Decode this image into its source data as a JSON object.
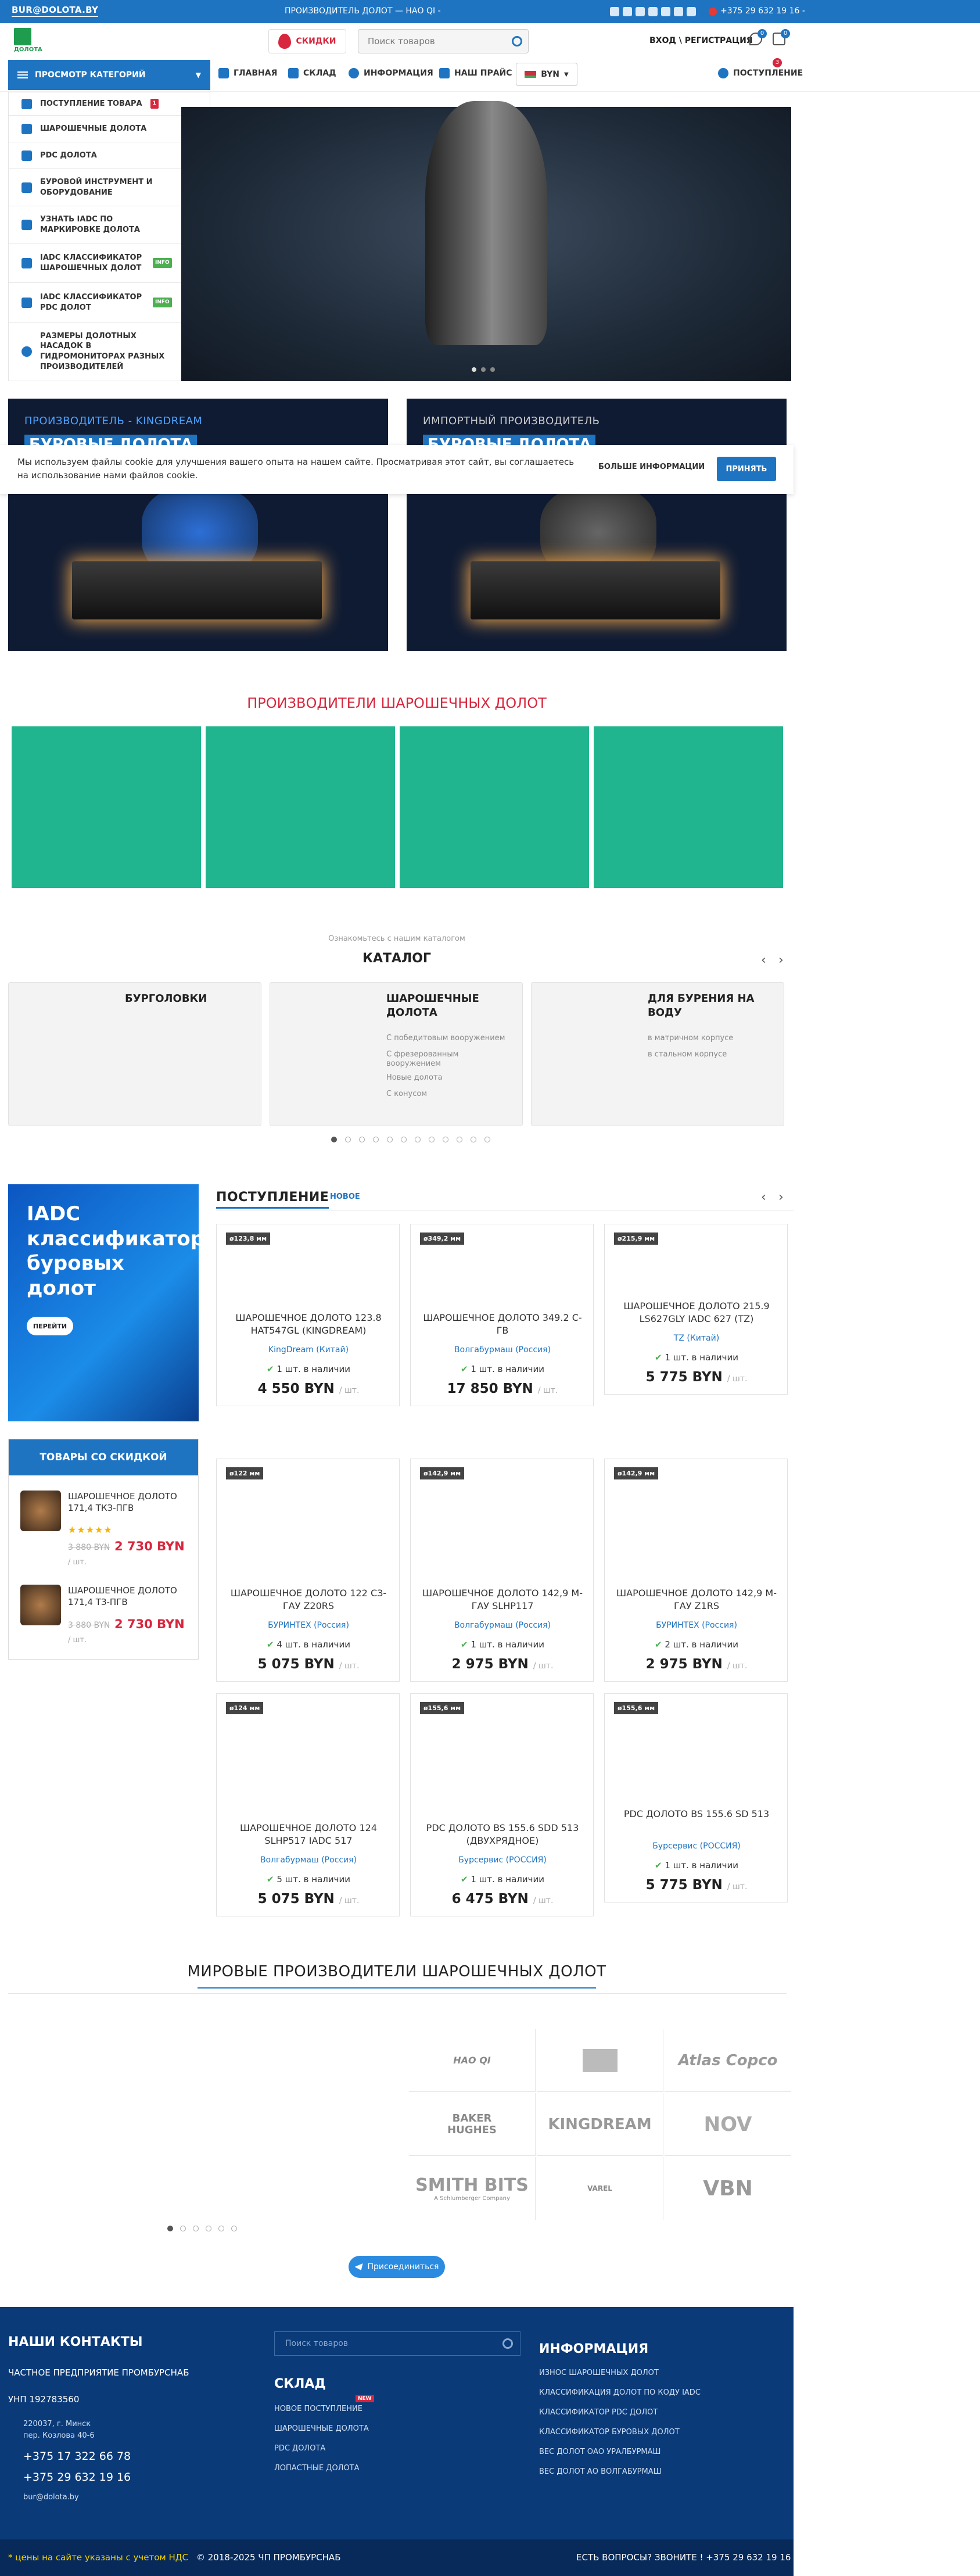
{
  "topbar": {
    "email": "BUR@DOLOTA.BY",
    "promo": "ПРОИЗВОДИТЕЛЬ ДОЛОТ — НАО QI -",
    "phone": "+375 29 632 19 16 -"
  },
  "header": {
    "logo_text": "ДОЛОТА",
    "sale_label": "СКИДКИ",
    "search_placeholder": "Поиск товаров",
    "login_label": "ВХОД \\ РЕГИСТРАЦИЯ",
    "wish_count": "0",
    "compare_count": "0"
  },
  "nav": {
    "category_button": "ПРОСМОТР КАТЕГОРИЙ",
    "items": [
      "ГЛАВНАЯ",
      "СКЛАД",
      "ИНФОРМАЦИЯ",
      "НАШ ПРАЙС"
    ],
    "currency": "BYN",
    "right_item": "ПОСТУПЛЕНИЕ",
    "right_badge": "3"
  },
  "categories": [
    {
      "label": "ПОСТУПЛЕНИЕ ТОВАРА",
      "tag": "1"
    },
    {
      "label": "ШАРОШЕЧНЫЕ ДОЛОТА",
      "tag": ""
    },
    {
      "label": "PDC ДОЛОТА",
      "tag": ""
    },
    {
      "label": "БУРОВОЙ ИНСТРУМЕНТ И ОБОРУДОВАНИЕ",
      "tag": ""
    },
    {
      "label": "УЗНАТЬ IADC ПО МАРКИРОВКЕ ДОЛОТА",
      "tag": ""
    },
    {
      "label": "IADC КЛАССИФИКАТОР ШАРОШЕЧНЫХ ДОЛОТ",
      "tag": "INFO"
    },
    {
      "label": "IADC КЛАССИФИКАТОР PDC ДОЛОТ",
      "tag": "INFO"
    },
    {
      "label": "РАЗМЕРЫ ДОЛОТНЫХ НАСАДОК В ГИДРОМОНИТОРАХ РАЗНЫХ ПРОИЗВОДИТЕЛЕЙ",
      "tag": ""
    }
  ],
  "promos": [
    {
      "kicker": "ПРОИЗВОДИТЕЛЬ - KINGDREAM",
      "title": "БУРОВЫЕ ДОЛОТА"
    },
    {
      "kicker": "ИМПОРТНЫЙ ПРОИЗВОДИТЕЛЬ",
      "title": "БУРОВЫЕ ДОЛОТА"
    }
  ],
  "cookie": {
    "text": "Мы используем файлы cookie для улучшения вашего опыта на нашем сайте. Просматривая этот сайт, вы соглашаетесь на использование нами файлов cookie.",
    "more": "БОЛЬШЕ ИНФОРМАЦИИ",
    "accept": "ПРИНЯТЬ"
  },
  "manufacturers_title": "ПРОИЗВОДИТЕЛИ ШАРОШЕЧНЫХ ДОЛОТ",
  "catalog": {
    "kicker": "Ознакомьтесь с нашим каталогом",
    "title": "КАТАЛОГ",
    "cards": [
      {
        "title": "БУРГОЛОВКИ",
        "subs": []
      },
      {
        "title": "ШАРОШЕЧНЫЕ ДОЛОТА",
        "subs": [
          "С победитовым вооружением",
          "С фрезерованным вооружением",
          "Новые долота",
          "С конусом"
        ]
      },
      {
        "title": "ДЛЯ БУРЕНИЯ НА ВОДУ",
        "subs": [
          "в матричном корпусе",
          "в стальном корпусе"
        ]
      }
    ]
  },
  "iadc": {
    "title": "IADC классификатор буровых долот",
    "button": "ПЕРЕЙТИ"
  },
  "discounts": {
    "title": "ТОВАРЫ СО СКИДКОЙ",
    "items": [
      {
        "name": "ШАРОШЕЧНОЕ ДОЛОТО 171,4 ТКЗ-ПГВ",
        "old": "3 880  BYN",
        "new": "2 730  BYN",
        "unit": "/ шт.",
        "stars": "★★★★★"
      },
      {
        "name": "ШАРОШЕЧНОЕ ДОЛОТО 171,4 ТЗ-ПГВ",
        "old": "3 880  BYN",
        "new": "2 730  BYN",
        "unit": "/ шт.",
        "stars": ""
      }
    ]
  },
  "arrivals": {
    "title": "ПОСТУПЛЕНИЕ",
    "subtitle": "НОВОЕ",
    "products": [
      {
        "size": "ø123,8 мм",
        "name": "ШАРОШЕЧНОЕ ДОЛОТО 123.8 HAT547GL (KINGDREAM)",
        "mfr": "KingDream (Китай)",
        "stock": "1 шт. в наличии",
        "price": "4 550  BYN",
        "unit": "/ шт."
      },
      {
        "size": "ø349,2 мм",
        "name": "ШАРОШЕЧНОЕ ДОЛОТО 349.2 С-ГВ",
        "mfr": "Волгабурмаш (Россия)",
        "stock": "1 шт. в наличии",
        "price": "17 850  BYN",
        "unit": "/ шт."
      },
      {
        "size": "ø215,9 мм",
        "name": "ШАРОШЕЧНОЕ ДОЛОТО 215.9 LS627GLY IADC 627 (TZ)",
        "mfr": "TZ (Китай)",
        "stock": "1 шт. в наличии",
        "price": "5 775  BYN",
        "unit": "/ шт."
      },
      {
        "size": "ø122 мм",
        "name": "ШАРОШЕЧНОЕ ДОЛОТО 122 СЗ-ГАУ Z20RS",
        "mfr": "БУРИНТЕХ (Россия)",
        "stock": "4 шт. в наличии",
        "price": "5 075  BYN",
        "unit": "/ шт."
      },
      {
        "size": "ø142,9 мм",
        "name": "ШАРОШЕЧНОЕ ДОЛОТО 142,9 М-ГАУ SLHP117",
        "mfr": "Волгабурмаш (Россия)",
        "stock": "1 шт. в наличии",
        "price": "2 975  BYN",
        "unit": "/ шт."
      },
      {
        "size": "ø142,9 мм",
        "name": "ШАРОШЕЧНОЕ ДОЛОТО 142,9 М-ГАУ Z1RS",
        "mfr": "БУРИНТЕХ (Россия)",
        "stock": "2 шт. в наличии",
        "price": "2 975  BYN",
        "unit": "/ шт."
      },
      {
        "size": "ø124 мм",
        "name": "ШАРОШЕЧНОЕ ДОЛОТО 124 SLHP517 IADC 517",
        "mfr": "Волгабурмаш (Россия)",
        "stock": "5 шт. в наличии",
        "price": "5 075  BYN",
        "unit": "/ шт."
      },
      {
        "size": "ø155,6 мм",
        "name": "PDC ДОЛОТО BS 155.6 SDD 513 (ДВУХРЯДНОЕ)",
        "mfr": "Бурсервис (РОССИЯ)",
        "stock": "1 шт. в наличии",
        "price": "6 475  BYN",
        "unit": "/ шт."
      },
      {
        "size": "ø155,6 мм",
        "name": "PDC ДОЛОТО BS 155.6 SD 513",
        "mfr": "Бурсервис (РОССИЯ)",
        "stock": "1 шт. в наличии",
        "price": "5 775  BYN",
        "unit": "/ шт."
      }
    ]
  },
  "world": {
    "title": "МИРОВЫЕ ПРОИЗВОДИТЕЛИ ШАРОШЕЧНЫХ ДОЛОТ",
    "brands": [
      "НАО QI",
      "",
      "Atlas Copco",
      "BAKER HUGHES",
      "KINGDREAM",
      "NOV",
      "SMITH BITS",
      "VAREL",
      "VBN"
    ],
    "smith_sub": "A Schlumberger Company",
    "join": "Присоединиться"
  },
  "footer": {
    "contacts_title": "НАШИ КОНТАКТЫ",
    "company": "ЧАСТНОЕ ПРЕДПРИЯТИЕ ПРОМБУРСНАБ",
    "unp": "УНП 192783560",
    "addr1": "220037, г. Минск",
    "addr2": "пер. Козлова 40-6",
    "phone1": "+375 17 322 66 78",
    "phone2": "+375 29 632 19 16",
    "email": "bur@dolota.by",
    "search_placeholder": "Поиск товаров",
    "stock_title": "СКЛАД",
    "stock_links": [
      "НОВОЕ ПОСТУПЛЕНИЕ",
      "ШАРОШЕЧНЫЕ ДОЛОТА",
      "PDC ДОЛОТА",
      "ЛОПАСТНЫЕ ДОЛОТА"
    ],
    "new_tag": "NEW",
    "info_title": "ИНФОРМАЦИЯ",
    "info_links": [
      "ИЗНОС ШАРОШЕЧНЫХ ДОЛОТ",
      "КЛАССИФИКАЦИЯ ДОЛОТ ПО КОДУ IADC",
      "КЛАССИФИКАТОР PDC ДОЛОТ",
      "КЛАССИФИКАТОР БУРОВЫХ ДОЛОТ",
      "ВЕС ДОЛОТ ОАО УРАЛБУРМАШ",
      "ВЕС ДОЛОТ АО ВОЛГАБУРМАШ"
    ],
    "vat_note": "* цены на сайте указаны с учетом НДС",
    "copyright": "© 2018-2025 ЧП ПРОМБУРСНАБ",
    "questions": "ЕСТЬ ВОПРОСЫ? ЗВОНИТЕ ! +375 29 632 19 16"
  },
  "colors": {
    "brand": "#1f74c2",
    "accent_red": "#d7263d",
    "teal": "#20b58e",
    "footer": "#0b3a78"
  }
}
